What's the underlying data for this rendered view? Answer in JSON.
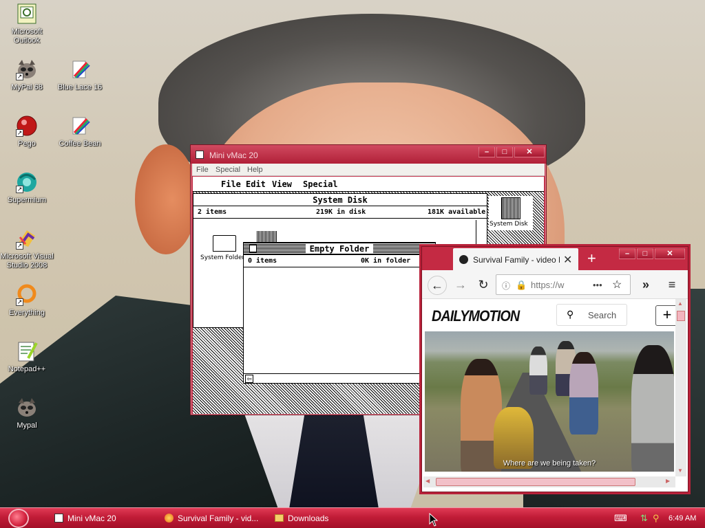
{
  "desktop": {
    "icons": [
      {
        "label": "Microsoft Outlook",
        "icon": "outlook-icon"
      },
      {
        "label": "MyPal 68",
        "icon": "mypal-icon"
      },
      {
        "label": "Blue Lace 16",
        "icon": "blue-lace-icon"
      },
      {
        "label": "Pego",
        "icon": "pego-icon"
      },
      {
        "label": "Coffee Bean",
        "icon": "coffee-bean-icon"
      },
      {
        "label": "Supermium",
        "icon": "supermium-icon"
      },
      {
        "label": "Microsoft Visual Studio 2008",
        "icon": "visual-studio-icon"
      },
      {
        "label": "Everything",
        "icon": "everything-icon"
      },
      {
        "label": "Notepad++",
        "icon": "notepadpp-icon"
      },
      {
        "label": "Mypal",
        "icon": "mypal-icon"
      }
    ]
  },
  "vmac": {
    "title": "Mini vMac 20",
    "menu": [
      "File",
      "Special",
      "Help"
    ],
    "mac_menu": [
      "File",
      "Edit",
      "View",
      "Special"
    ],
    "system_disk": {
      "title": "System Disk",
      "items": "2 items",
      "in_disk": "219K in disk",
      "available": "181K available",
      "folder_label": "System Folder"
    },
    "desktop_disk_label": "System Disk",
    "empty_folder": {
      "title": "Empty Folder",
      "items": "0 items",
      "in_folder": "0K in folder"
    }
  },
  "firefox": {
    "tab_title": "Survival Family - video Dail",
    "url": "https://w",
    "search_label": "Search",
    "logo": "DAILYMOTION",
    "subtitle": "Where are we being taken?"
  },
  "taskbar": {
    "tasks": [
      "Mini vMac 20",
      "Survival Family - vid...",
      "Downloads"
    ],
    "clock": "6:49 AM"
  },
  "colors": {
    "accent": "#c42a43",
    "taskbar": "#c11c37"
  }
}
